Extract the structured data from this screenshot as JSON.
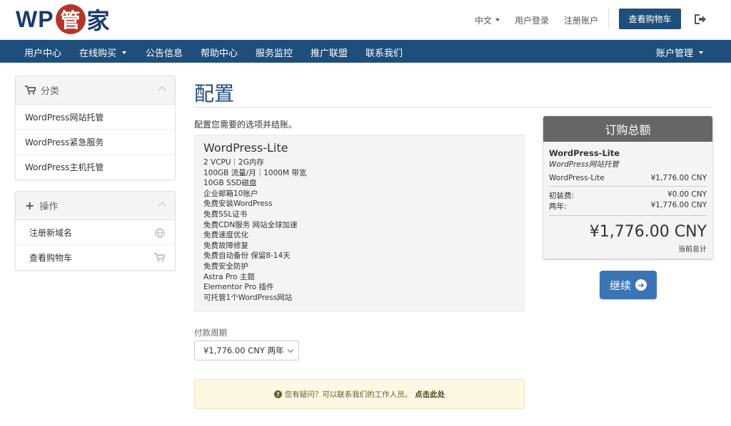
{
  "header": {
    "logo_prefix": "WP",
    "logo_circle": "管",
    "logo_suffix": "家",
    "language": "中文",
    "login": "用户登录",
    "register": "注册账户",
    "cart_button": "查看购物车"
  },
  "nav": {
    "items": [
      "用户中心",
      "在线购买",
      "公告信息",
      "帮助中心",
      "服务监控",
      "推广联盟",
      "联系我们"
    ],
    "account": "账户管理"
  },
  "sidebar": {
    "categories": {
      "title": "分类",
      "items": [
        "WordPress网站托管",
        "WordPress紧急服务",
        "WordPress主机托管"
      ]
    },
    "actions": {
      "title": "操作",
      "items": [
        "注册新域名",
        "查看购物车"
      ]
    }
  },
  "main": {
    "title": "配置",
    "intro": "配置您需要的选项并结账。",
    "product": {
      "name": "WordPress-Lite",
      "features": [
        "2 VCPU｜2G内存",
        "100GB 流量/月｜1000M 带宽",
        "10GB SSD磁盘",
        "企业邮箱10账户",
        "免费安装WordPress",
        "免费SSL证书",
        "免费CDN服务 网站全球加速",
        "免费速度优化",
        "免费故障修复",
        "免费自动备份 保留8-14天",
        "免费安全防护",
        "Astra Pro 主题",
        "Elementor Pro 插件",
        "可托管1个WordPress网站"
      ]
    },
    "billing_label": "付款周期",
    "billing_value": "¥1,776.00 CNY 两年",
    "help_text": "您有疑问？可以联系我们的工作人员。",
    "help_link": "点击此处"
  },
  "summary": {
    "title": "订购总额",
    "product": "WordPress-Lite",
    "group": "WordPress网站托管",
    "line_name": "WordPress-Lite",
    "line_price": "¥1,776.00 CNY",
    "setup_label": "初装费:",
    "setup_value": "¥0.00 CNY",
    "period_label": "两年:",
    "period_value": "¥1,776.00 CNY",
    "total": "¥1,776.00 CNY",
    "total_label": "当前总计",
    "continue": "继续"
  },
  "colors": {
    "brand": "#1f4e7c",
    "logo_red": "#b5342a",
    "button_blue": "#3a74b5"
  }
}
